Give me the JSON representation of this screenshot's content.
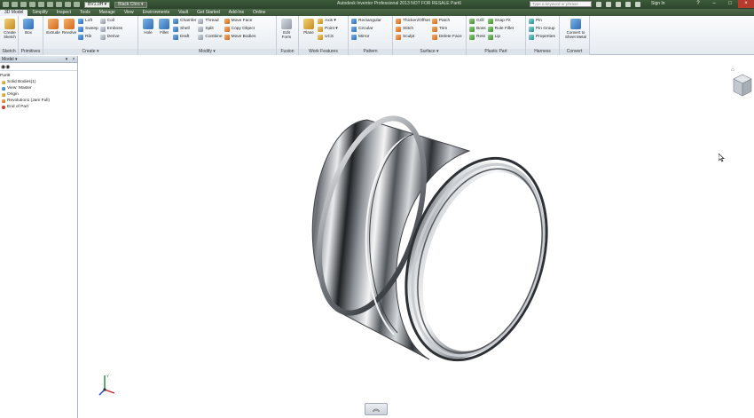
{
  "titlebar": {
    "style_dropdown": "BV1.0H",
    "material_dropdown": "Black Chro",
    "app_title": "Autodesk Inventor Professional 2013   NOT FOR RESALE   Part6",
    "help_search_placeholder": "Type a keyword or phrase",
    "sign_in": "Sign In"
  },
  "tabs": [
    "3D Model",
    "Simplify",
    "Inspect",
    "Tools",
    "Manage",
    "View",
    "Environments",
    "Vault",
    "Get Started",
    "Add-Ins",
    "Online"
  ],
  "ribbon": {
    "sketch": {
      "label": "Create Sketch",
      "title": "Sketch"
    },
    "primitives": {
      "box": "Box",
      "title": "Primitives"
    },
    "create": {
      "extrude": "Extrude",
      "revolve": "Revolve",
      "loft": "Loft",
      "sweep": "Sweep",
      "rib": "Rib",
      "coil": "Coil",
      "emboss": "Emboss",
      "derive": "Derive",
      "title": "Create ▾"
    },
    "modify": {
      "hole": "Hole",
      "fillet": "Fillet",
      "chamfer": "Chamfer",
      "shell": "Shell",
      "draft": "Draft",
      "thread": "Thread",
      "split": "Split",
      "combine": "Combine",
      "move_face": "Move Face",
      "copy_object": "Copy Object",
      "move_bodies": "Move Bodies",
      "title": "Modify ▾"
    },
    "fusion": {
      "edit_form": "Edit Form",
      "title": "Fusion"
    },
    "work_features": {
      "plane": "Plane",
      "axis": "Axis ▾",
      "point": "Point ▾",
      "ucs": "UCS",
      "title": "Work Features"
    },
    "pattern": {
      "rectangular": "Rectangular",
      "circular": "Circular",
      "mirror": "Mirror",
      "title": "Pattern"
    },
    "surface": {
      "thicken": "Thicken/Offset",
      "stitch": "Stitch",
      "sculpt": "Sculpt",
      "patch": "Patch",
      "trim": "Trim",
      "delete_face": "Delete Face",
      "title": "Surface ▾"
    },
    "plastic_part": {
      "grill": "Grill",
      "boss": "Boss",
      "rest": "Rest",
      "snap_fit": "Snap Fit",
      "rule_fillet": "Rule Fillet",
      "lip": "Lip",
      "title": "Plastic Part"
    },
    "harness": {
      "pin": "Pin",
      "pin_group": "Pin Group",
      "properties": "Properties",
      "title": "Harness"
    },
    "convert": {
      "label": "Convert to Sheet Metal",
      "title": "Convert"
    }
  },
  "browser": {
    "header": "Model",
    "tree": [
      "Part6",
      "Solid Bodies(1)",
      "View: Master",
      "Origin",
      "Revolution1 (Jam Full)",
      "End of Part"
    ]
  },
  "colors": {
    "title_green": "#2c442b",
    "ribbon_bg": "#e6ebf1",
    "viewport_bg": "#ffffff"
  }
}
